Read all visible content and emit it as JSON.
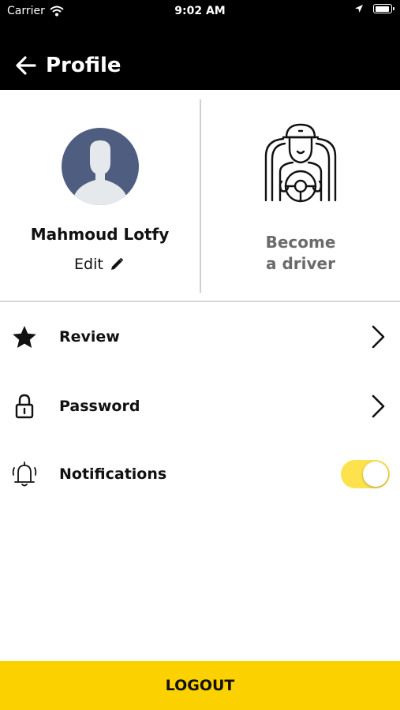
{
  "status_bar": {
    "carrier": "Carrier",
    "time": "9:02 AM",
    "icons": [
      "wifi-icon",
      "location-arrow-icon",
      "battery-icon"
    ]
  },
  "header": {
    "title": "Profile",
    "back_icon": "arrow-left-icon"
  },
  "profile": {
    "name": "Mahmoud Lotfy",
    "edit_label": "Edit",
    "edit_icon": "pencil-icon"
  },
  "driver": {
    "label_line1": "Become",
    "label_line2": "a driver",
    "icon": "driver-icon"
  },
  "menu": {
    "items": [
      {
        "label": "Review",
        "icon": "star-icon"
      },
      {
        "label": "Password",
        "icon": "lock-icon"
      },
      {
        "label": "Notifications",
        "icon": "bell-icon",
        "toggle_on": true
      }
    ]
  },
  "colors": {
    "accent": "#fcd100",
    "toggle": "#fde24d",
    "avatar_bg": "#4f5e80",
    "header_bg": "#000000"
  },
  "logout_label": "LOGOUT"
}
